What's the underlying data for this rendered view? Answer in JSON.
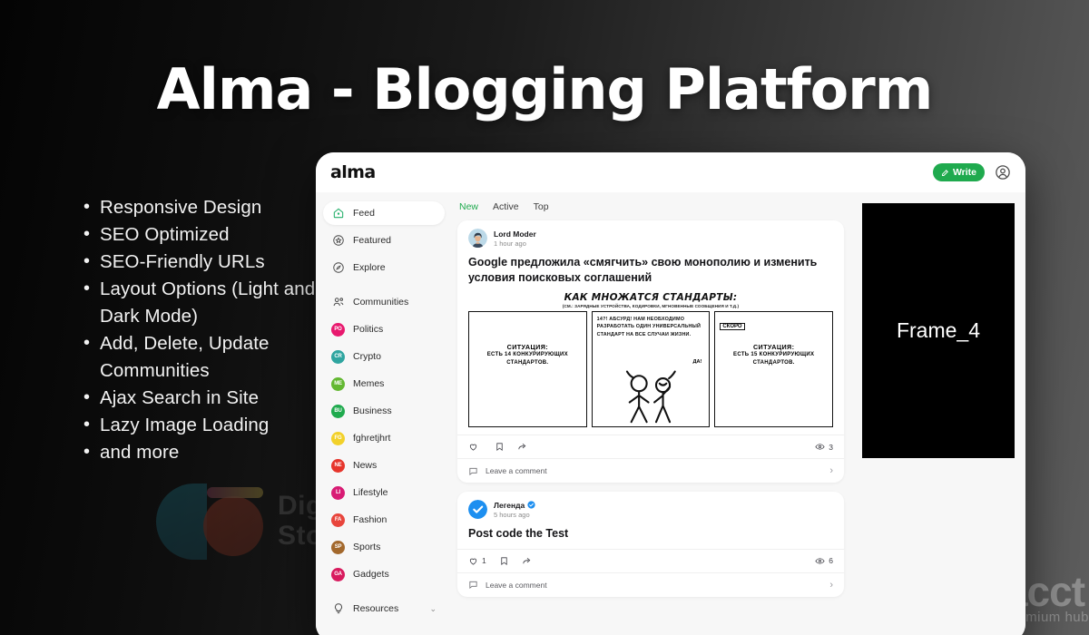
{
  "hero": {
    "title": "Alma - Blogging Platform",
    "features": [
      "Responsive Design",
      "SEO Optimized",
      "SEO-Friendly URLs",
      "Layout Options (Light and Dark Mode)",
      "Add, Delete, Update Communities",
      "Ajax Search in Site",
      "Lazy Image Loading",
      "and more"
    ]
  },
  "watermarks": {
    "left_line1": "Digg",
    "left_line2": "Stor",
    "right_main": "acct",
    "right_sub": "premium hub"
  },
  "app": {
    "logo": "alma",
    "write_label": "Write",
    "write_color": "#1faa4e",
    "account_icon": "user-circle-icon",
    "sidebar": {
      "primary": [
        {
          "label": "Feed",
          "icon": "home-icon",
          "active": true
        },
        {
          "label": "Featured",
          "icon": "star-circle-icon",
          "active": false
        },
        {
          "label": "Explore",
          "icon": "compass-icon",
          "active": false
        }
      ],
      "communities_label": "Communities",
      "communities_icon": "users-icon",
      "communities": [
        {
          "label": "Politics",
          "initials": "PO",
          "color": "#e8196e"
        },
        {
          "label": "Crypto",
          "initials": "CR",
          "color": "#2fa5a0"
        },
        {
          "label": "Memes",
          "initials": "ME",
          "color": "#63b832"
        },
        {
          "label": "Business",
          "initials": "BU",
          "color": "#1faa4e"
        },
        {
          "label": "fghretjhrt",
          "initials": "FG",
          "color": "#f2d12a"
        },
        {
          "label": "News",
          "initials": "NE",
          "color": "#e6352b"
        },
        {
          "label": "Lifestyle",
          "initials": "LI",
          "color": "#d81b74"
        },
        {
          "label": "Fashion",
          "initials": "FA",
          "color": "#e8453c"
        },
        {
          "label": "Sports",
          "initials": "SP",
          "color": "#a3682c"
        },
        {
          "label": "Gadgets",
          "initials": "GA",
          "color": "#d81b5e"
        }
      ],
      "resources_label": "Resources",
      "resources_icon": "lightbulb-icon",
      "resources_chevron": "chevron-down-icon"
    },
    "tabs": [
      {
        "label": "New",
        "active": true
      },
      {
        "label": "Active",
        "active": false
      },
      {
        "label": "Top",
        "active": false
      }
    ],
    "posts": [
      {
        "author": "Lord Moder",
        "verified": false,
        "time": "1 hour ago",
        "title": "Google предложила «смягчить» свою монополию и изменить условия поисковых соглашений",
        "likes": "",
        "views": "3",
        "comment_placeholder": "Leave a comment",
        "like_icon": "heart-icon",
        "bookmark_icon": "bookmark-icon",
        "share_icon": "share-icon",
        "views_icon": "eye-icon",
        "comment_icon": "comment-icon",
        "chevron_icon": "chevron-right-icon",
        "comic": {
          "title": "КАК МНОЖАТСЯ СТАНДАРТЫ:",
          "subtitle": "(СМ.: ЗАРЯДНЫЕ УСТРОЙСТВА, КОДИРОВКИ, МГНОВЕННЫЕ СООБЩЕНИЯ И Т.Д.)",
          "panel1_l1": "СИТУАЦИЯ:",
          "panel1_l2": "ЕСТЬ 14 КОНКУРИРУЮЩИХ СТАНДАРТОВ.",
          "panel2_text": "14?! АБСУРД! НАМ НЕОБХОДИМО РАЗРАБОТАТЬ ОДИН УНИВЕРСАЛЬНЫЙ СТАНДАРТ НА ВСЕ СЛУЧАИ ЖИЗНИ.",
          "panel2_reply": "ДА!",
          "panel3_tag": "СКОРО",
          "panel3_l1": "СИТУАЦИЯ:",
          "panel3_l2": "ЕСТЬ 15 КОНКУРИРУЮЩИХ СТАНДАРТОВ."
        }
      },
      {
        "author": "Легенда",
        "verified": true,
        "time": "5 hours ago",
        "title": "Post code the Test",
        "likes": "1",
        "views": "6",
        "comment_placeholder": "Leave a comment",
        "like_icon": "heart-icon",
        "bookmark_icon": "bookmark-icon",
        "share_icon": "share-icon",
        "views_icon": "eye-icon",
        "comment_icon": "comment-icon",
        "chevron_icon": "chevron-right-icon"
      }
    ],
    "frame": {
      "label": "Frame_4"
    }
  }
}
